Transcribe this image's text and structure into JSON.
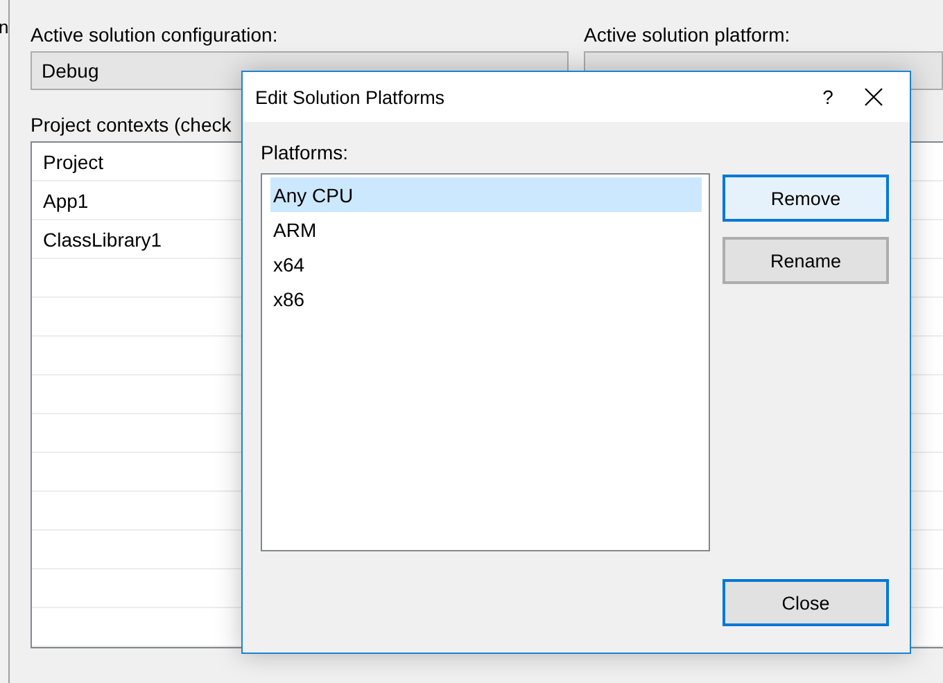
{
  "background_window": {
    "sidebar_fragment": "n",
    "configuration_label": "Active solution configuration:",
    "configuration_value": "Debug",
    "platform_label": "Active solution platform:",
    "contexts_label": "Project contexts (check",
    "table": {
      "columns": [
        "Project"
      ],
      "rows": [
        {
          "project": "App1"
        },
        {
          "project": "ClassLibrary1"
        }
      ]
    }
  },
  "dialog": {
    "title": "Edit Solution Platforms",
    "help_button": "?",
    "platforms_label": "Platforms:",
    "platforms": [
      {
        "label": "Any CPU",
        "selected": true
      },
      {
        "label": "ARM",
        "selected": false
      },
      {
        "label": "x64",
        "selected": false
      },
      {
        "label": "x86",
        "selected": false
      }
    ],
    "side_buttons": [
      {
        "label": "Remove",
        "kind": "hover"
      },
      {
        "label": "Rename",
        "kind": "normal"
      }
    ],
    "footer_buttons": [
      {
        "label": "Close",
        "kind": "default"
      }
    ]
  }
}
